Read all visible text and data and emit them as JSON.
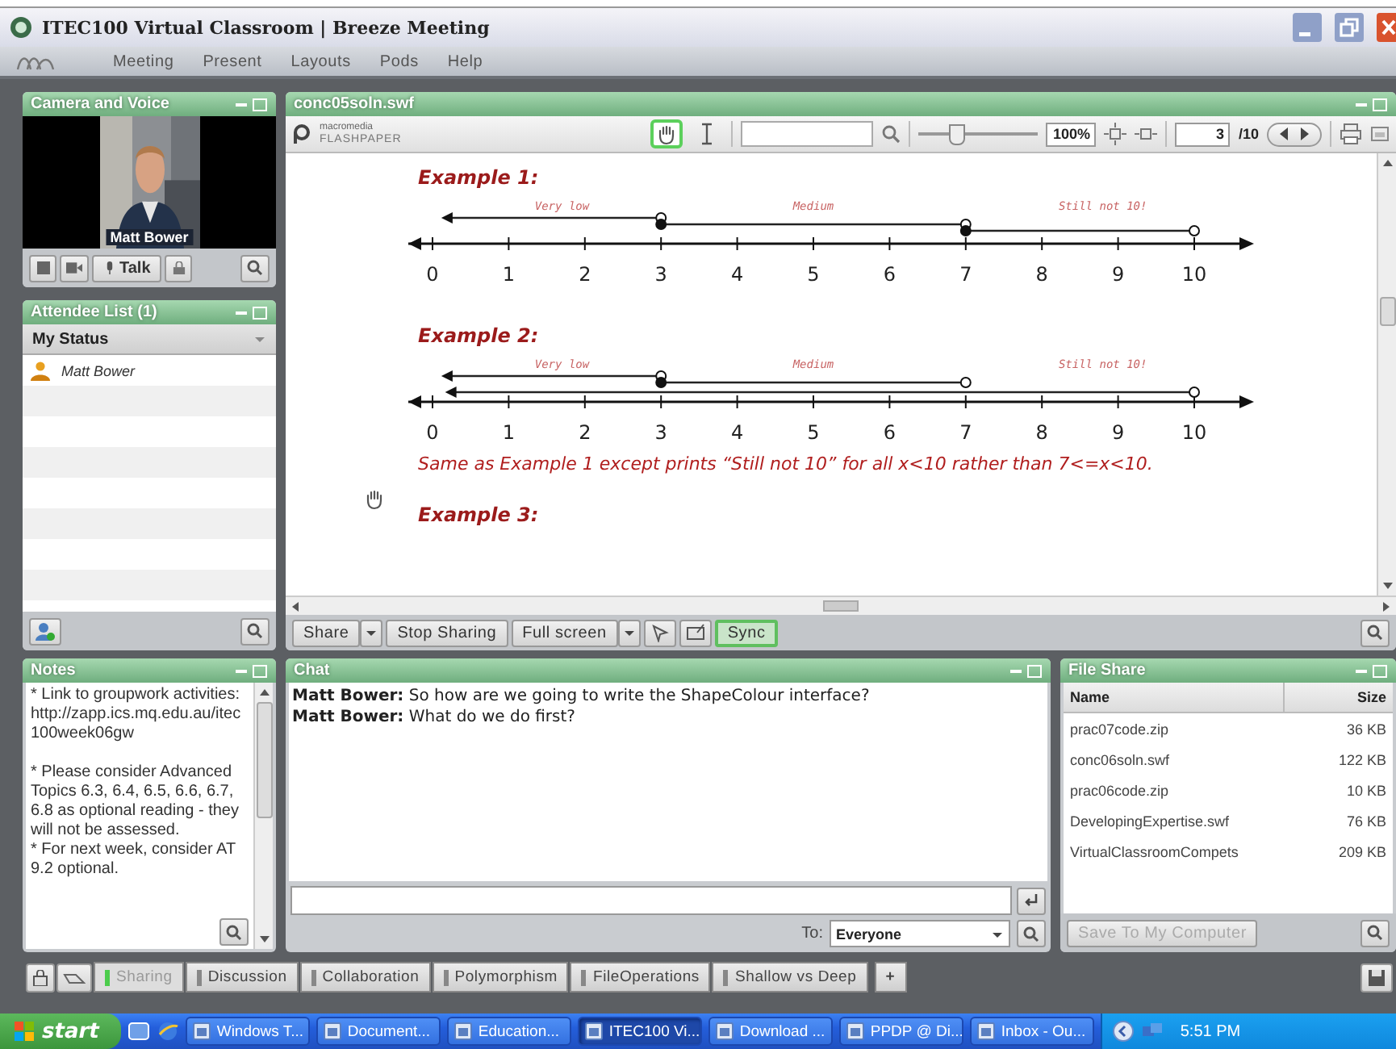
{
  "window": {
    "title": "ITEC100 Virtual Classroom | Breeze Meeting"
  },
  "menu": [
    "Meeting",
    "Present",
    "Layouts",
    "Pods",
    "Help"
  ],
  "camera_pod": {
    "title": "Camera and Voice",
    "presenter": "Matt Bower",
    "talk_label": "Talk"
  },
  "attendee_pod": {
    "title": "Attendee List (1)",
    "header": "My Status",
    "attendees": [
      {
        "name": "Matt Bower"
      }
    ]
  },
  "share_pod": {
    "title": "conc05soln.swf",
    "logo_top": "macromedia",
    "logo_bottom": "FLASHPAPER",
    "tools": [
      {
        "kind": "hand",
        "selected": true
      },
      {
        "kind": "text",
        "selected": false
      }
    ],
    "zoom": {
      "level": 0.3,
      "value": "100%"
    },
    "page": "3",
    "page_total": "/10",
    "examples": [
      {
        "title": "Example 1:",
        "labels": [
          "Very low",
          "Medium",
          "Still not 10!"
        ],
        "ticks": [
          "0",
          "1",
          "2",
          "3",
          "4",
          "5",
          "6",
          "7",
          "8",
          "9",
          "10"
        ]
      },
      {
        "title": "Example 2:",
        "labels": [
          "Very low",
          "Medium",
          "Still not 10!"
        ],
        "ticks": [
          "0",
          "1",
          "2",
          "3",
          "4",
          "5",
          "6",
          "7",
          "8",
          "9",
          "10"
        ],
        "note": "Same as Example 1 except prints “Still not 10” for all x<10 rather than 7<=x<10."
      },
      {
        "title": "Example 3:"
      }
    ],
    "buttons": [
      {
        "label": "Share",
        "dropdown": true
      },
      {
        "label": "Stop Sharing",
        "dropdown": false
      },
      {
        "label": "Full screen",
        "dropdown": true
      }
    ],
    "sync": {
      "label": "Sync",
      "on": true
    }
  },
  "notes_pod": {
    "title": "Notes",
    "text": "* Link to groupwork activities: http://zapp.ics.mq.edu.au/itec100week06gw\n\n* Please consider Advanced Topics 6.3, 6.4, 6.5, 6.6, 6.7, 6.8 as optional reading - they will not be assessed.\n* For next week, consider AT 9.2 optional."
  },
  "chat_pod": {
    "title": "Chat",
    "messages": [
      "**Matt Bower:** So how are we going to write the ShapeColour interface?",
      "**Matt Bower:** What do we do first?"
    ],
    "to_label": "To:",
    "recipient": "Everyone"
  },
  "file_pod": {
    "title": "File Share",
    "columns": [
      "Name",
      "Size"
    ],
    "rows": [
      {
        "name": "prac07code.zip",
        "size": "36 KB"
      },
      {
        "name": "conc06soln.swf",
        "size": "122 KB"
      },
      {
        "name": "prac06code.zip",
        "size": "10 KB"
      },
      {
        "name": "DevelopingExpertise.swf",
        "size": "76 KB"
      },
      {
        "name": "VirtualClassroomCompets",
        "size": "209 KB"
      }
    ],
    "save_button": {
      "label": "Save To My Computer",
      "disabled": true
    }
  },
  "layout_tabs": [
    {
      "label": "Sharing",
      "selected": true
    },
    {
      "label": "Discussion",
      "selected": false
    },
    {
      "label": "Collaboration",
      "selected": false
    },
    {
      "label": "Polymorphism",
      "selected": false
    },
    {
      "label": "FileOperations",
      "selected": false
    },
    {
      "label": "Shallow vs Deep",
      "selected": false
    }
  ],
  "add_tab": "+",
  "taskbar": {
    "start": "start",
    "tasks": [
      {
        "label": "Windows T...",
        "selected": false
      },
      {
        "label": "Document...",
        "selected": false
      },
      {
        "label": "Education...",
        "selected": false
      },
      {
        "label": "ITEC100 Vi...",
        "selected": true
      },
      {
        "label": "Download ...",
        "selected": false
      },
      {
        "label": "PPDP @ Di...",
        "selected": false
      },
      {
        "label": "Inbox - Ou...",
        "selected": false
      }
    ],
    "clock": "5:51 PM"
  }
}
